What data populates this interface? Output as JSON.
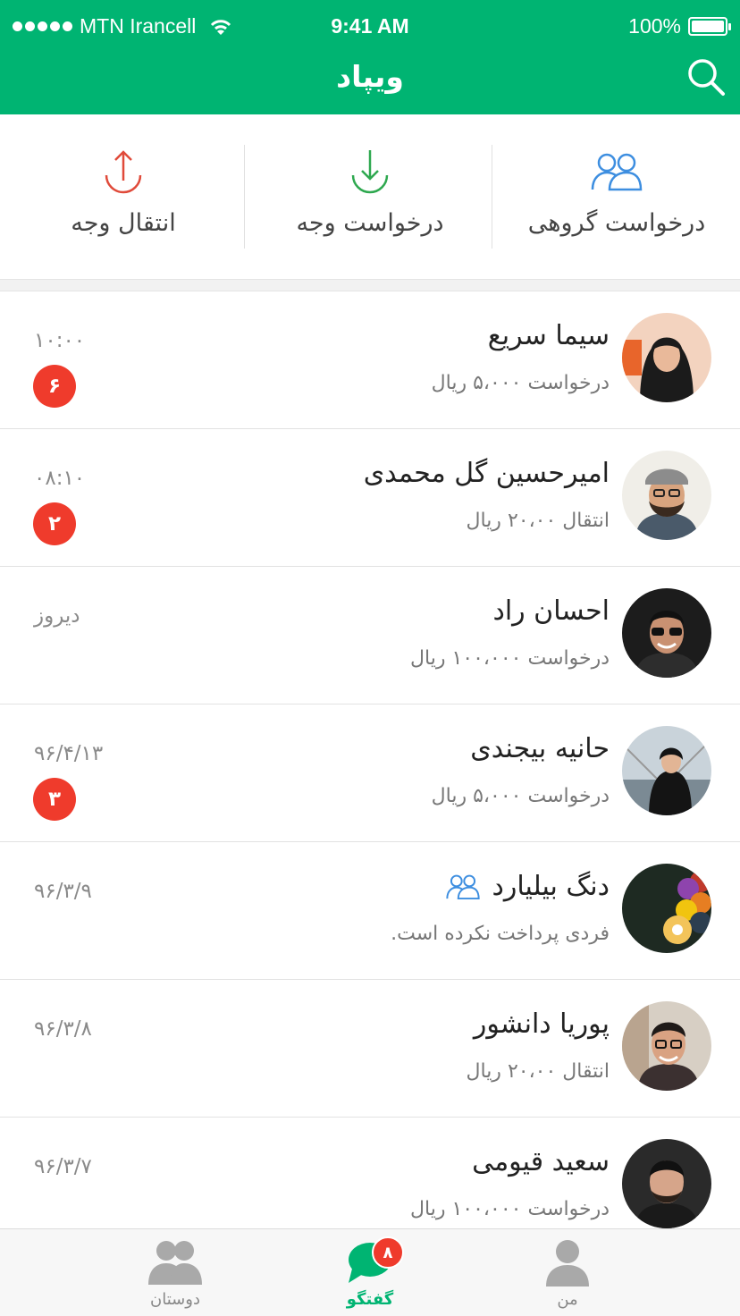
{
  "status_bar": {
    "carrier": "MTN Irancell",
    "time": "9:41 AM",
    "battery": "100%"
  },
  "header": {
    "title": "ویپاد",
    "search_icon": "search-icon"
  },
  "actions": [
    {
      "label": "درخواست گروهی",
      "icon": "group-icon",
      "color": "#3d8ee0"
    },
    {
      "label": "درخواست وجه",
      "icon": "download-arrow-icon",
      "color": "#2ea84f"
    },
    {
      "label": "انتقال وجه",
      "icon": "upload-arrow-icon",
      "color": "#e04a3a"
    }
  ],
  "conversations": [
    {
      "name": "سیما سریع",
      "subtitle": "درخواست ۵،۰۰۰ ریال",
      "time": "۱۰:۰۰",
      "badge": "۶",
      "is_group": false
    },
    {
      "name": "امیرحسین گل محمدی",
      "subtitle": "انتقال ۲۰،۰۰ ریال",
      "time": "۰۸:۱۰",
      "badge": "۲",
      "is_group": false
    },
    {
      "name": "احسان راد",
      "subtitle": "درخواست ۱۰۰،۰۰۰ ریال",
      "time": "دیروز",
      "badge": "",
      "is_group": false
    },
    {
      "name": "حانیه بیجندی",
      "subtitle": "درخواست ۵،۰۰۰ ریال",
      "time": "۹۶/۴/۱۳",
      "badge": "۳",
      "is_group": false
    },
    {
      "name": "دنگ بیلیارد",
      "subtitle": "فردی پرداخت نکرده است.",
      "time": "۹۶/۳/۹",
      "badge": "",
      "is_group": true
    },
    {
      "name": "پوریا دانشور",
      "subtitle": "انتقال ۲۰،۰۰ ریال",
      "time": "۹۶/۳/۸",
      "badge": "",
      "is_group": false
    },
    {
      "name": "سعید قیومی",
      "subtitle": "درخواست ۱۰۰،۰۰۰ ریال",
      "time": "۹۶/۳/۷",
      "badge": "",
      "is_group": false
    }
  ],
  "tabbar": {
    "tabs": [
      {
        "label": "دوستان",
        "icon": "friends-icon",
        "active": false
      },
      {
        "label": "گفتگو",
        "icon": "chat-icon",
        "active": true,
        "badge": "۸"
      },
      {
        "label": "من",
        "icon": "person-icon",
        "active": false
      }
    ]
  },
  "colors": {
    "brand": "#00b472",
    "badge": "#ef3b2c",
    "group_blue": "#3d8ee0"
  }
}
